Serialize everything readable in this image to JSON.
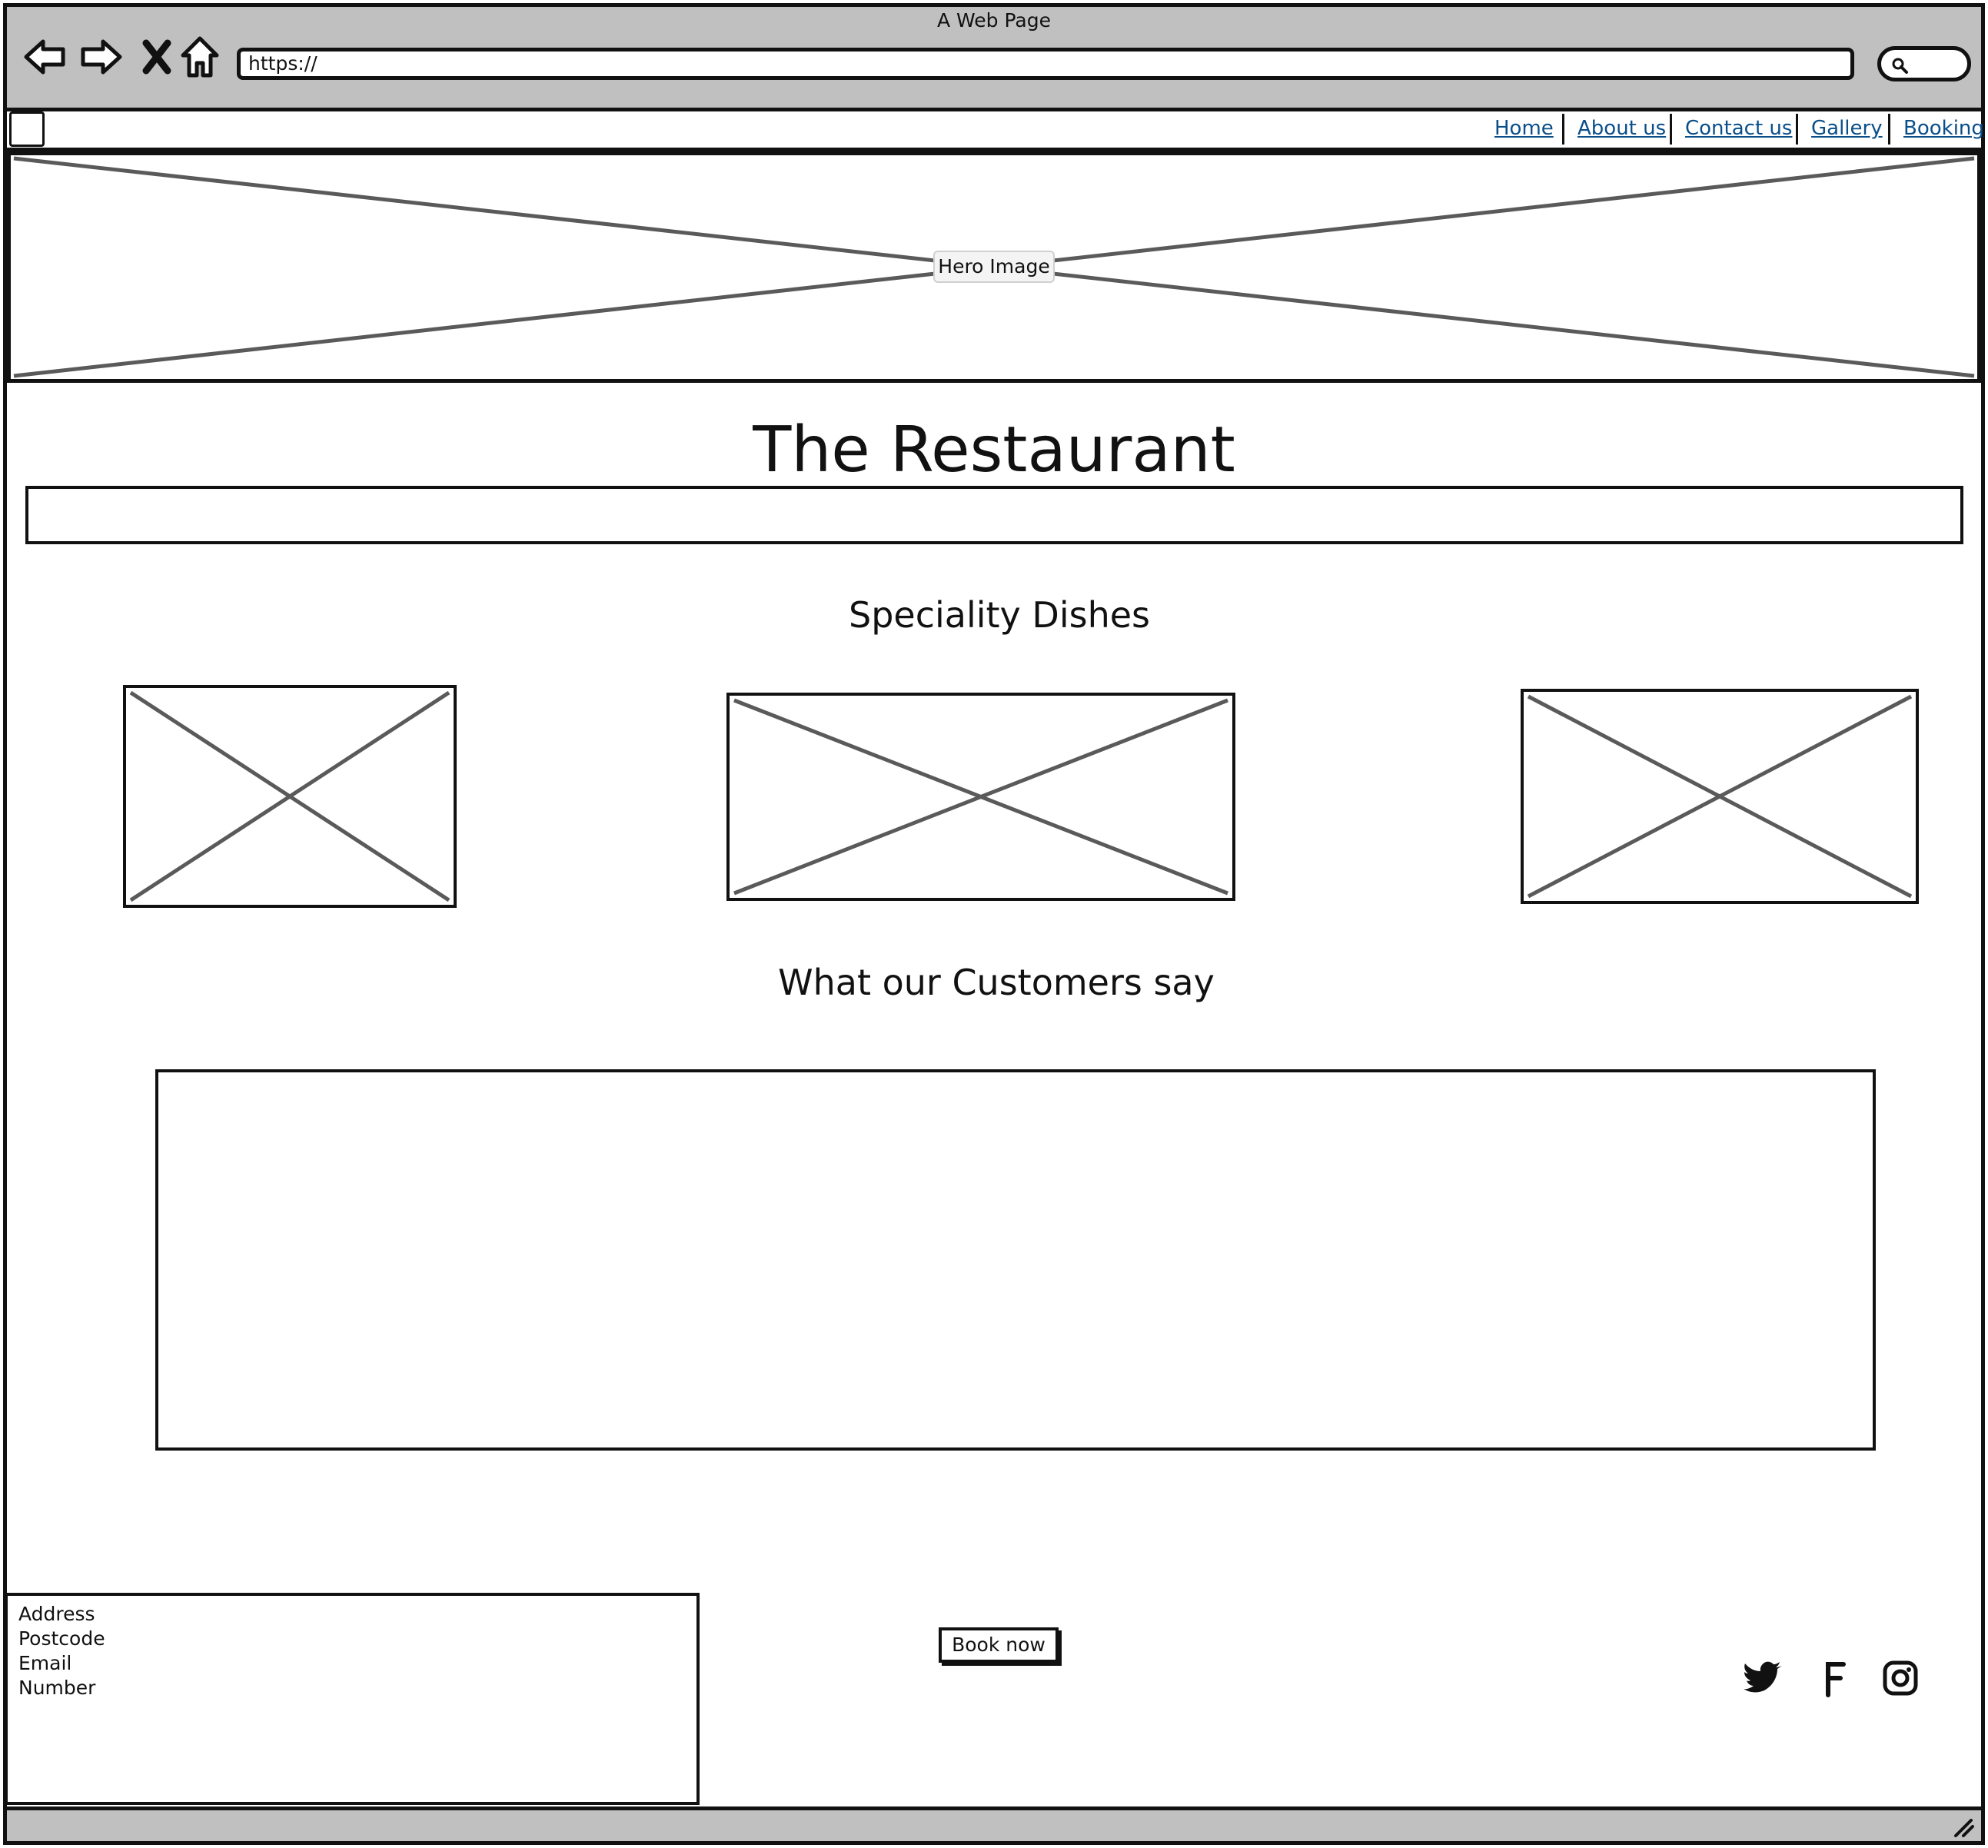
{
  "browser": {
    "title": "A Web Page",
    "url": "https://",
    "icons": [
      "back-arrow-icon",
      "forward-arrow-icon",
      "close-icon",
      "home-icon",
      "search-icon"
    ]
  },
  "nav": {
    "links": [
      "Home",
      "About us",
      "Contact us",
      "Gallery",
      "Booking"
    ]
  },
  "hero": {
    "label": "Hero Image"
  },
  "main": {
    "title": "The Restaurant",
    "speciality_heading": "Speciality Dishes",
    "customers_heading": "What our Customers say"
  },
  "footer": {
    "contact": [
      "Address",
      "Postcode",
      "Email",
      "Number"
    ],
    "book_label": "Book now",
    "social_icons": [
      "twitter-icon",
      "facebook-icon",
      "instagram-icon"
    ]
  }
}
